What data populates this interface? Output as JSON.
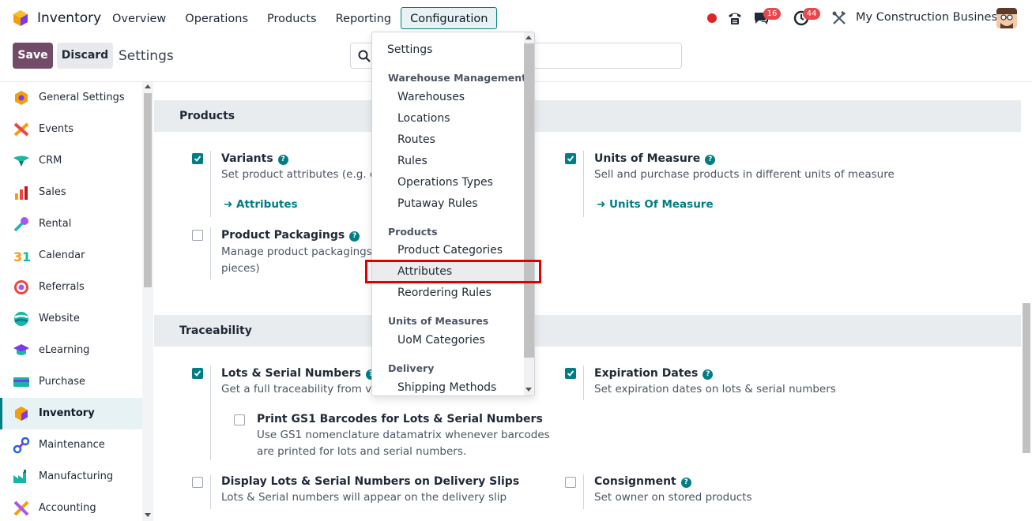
{
  "navbar": {
    "app_name": "Inventory",
    "menu": [
      "Overview",
      "Operations",
      "Products",
      "Reporting",
      "Configuration"
    ],
    "active_menu": "Configuration",
    "messages_count": "16",
    "activities_count": "44",
    "company": "My Construction Business"
  },
  "control_panel": {
    "save_label": "Save",
    "discard_label": "Discard",
    "title": "Settings",
    "search_placeholder": ""
  },
  "sidebar": {
    "items": [
      {
        "label": "General Settings",
        "icon": "general-settings-icon"
      },
      {
        "label": "Events",
        "icon": "events-icon"
      },
      {
        "label": "CRM",
        "icon": "crm-icon"
      },
      {
        "label": "Sales",
        "icon": "sales-icon"
      },
      {
        "label": "Rental",
        "icon": "rental-icon"
      },
      {
        "label": "Calendar",
        "icon": "calendar-icon"
      },
      {
        "label": "Referrals",
        "icon": "referrals-icon"
      },
      {
        "label": "Website",
        "icon": "website-icon"
      },
      {
        "label": "eLearning",
        "icon": "elearning-icon"
      },
      {
        "label": "Purchase",
        "icon": "purchase-icon"
      },
      {
        "label": "Inventory",
        "icon": "inventory-icon"
      },
      {
        "label": "Maintenance",
        "icon": "maintenance-icon"
      },
      {
        "label": "Manufacturing",
        "icon": "manufacturing-icon"
      },
      {
        "label": "Accounting",
        "icon": "accounting-icon"
      }
    ],
    "active": "Inventory"
  },
  "sections": {
    "products": {
      "title": "Products",
      "variants": {
        "title": "Variants",
        "desc": "Set product attributes (e.g. co",
        "link": "Attributes",
        "checked": true
      },
      "uom": {
        "title": "Units of Measure",
        "desc": "Sell and purchase products in different units of measure",
        "link": "Units Of Measure",
        "checked": true
      },
      "packagings": {
        "title": "Product Packagings",
        "desc1": "Manage product packagings (e",
        "desc2": "pieces)",
        "checked": false
      }
    },
    "traceability": {
      "title": "Traceability",
      "lots": {
        "title": "Lots & Serial Numbers",
        "desc": "Get a full traceability from ver",
        "checked": true
      },
      "expiration": {
        "title": "Expiration Dates",
        "desc": "Set expiration dates on lots & serial numbers",
        "checked": true
      },
      "gs1": {
        "title": "Print GS1 Barcodes for Lots & Serial Numbers",
        "desc1": "Use GS1 nomenclature datamatrix whenever barcodes",
        "desc2": "are printed for lots and serial numbers.",
        "checked": false
      },
      "delivery_slips": {
        "title": "Display Lots & Serial Numbers on Delivery Slips",
        "desc": "Lots & Serial numbers will appear on the delivery slip",
        "checked": false
      },
      "consignment": {
        "title": "Consignment",
        "desc": "Set owner on stored products",
        "checked": false
      }
    }
  },
  "dropdown": {
    "settings": "Settings",
    "groups": [
      {
        "header": "Warehouse Management",
        "items": [
          "Warehouses",
          "Locations",
          "Routes",
          "Rules",
          "Operations Types",
          "Putaway Rules"
        ]
      },
      {
        "header": "Products",
        "items": [
          "Product Categories",
          "Attributes",
          "Reordering Rules"
        ]
      },
      {
        "header": "Units of Measures",
        "items": [
          "UoM Categories"
        ]
      },
      {
        "header": "Delivery",
        "items": [
          "Shipping Methods"
        ]
      }
    ],
    "highlighted": "Attributes"
  },
  "colors": {
    "brand_primary": "#714b67",
    "accent": "#017e84",
    "highlight_box": "#e00000"
  }
}
